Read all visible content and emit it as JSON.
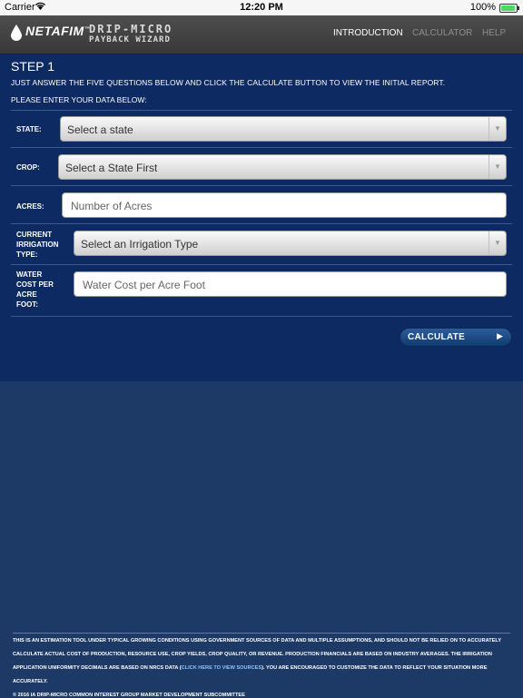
{
  "status_bar": {
    "carrier": "Carrier",
    "time": "12:20 PM",
    "battery": "100%",
    "wifi_icon": "wifi-icon",
    "battery_icon": "battery-icon"
  },
  "header": {
    "brand": "NETAFIM",
    "brand_tm": "™",
    "title_line1": "DRIP-MICRO",
    "title_line2": "PAYBACK WIZARD",
    "nav": [
      {
        "label": "INTRODUCTION",
        "active": true
      },
      {
        "label": "CALCULATOR",
        "active": false
      },
      {
        "label": "HELP",
        "active": false
      }
    ]
  },
  "main": {
    "step_title": "STEP 1",
    "intro": "JUST ANSWER THE FIVE QUESTIONS BELOW AND CLICK THE CALCULATE BUTTON TO VIEW THE INITIAL REPORT.",
    "enter_prompt": "PLEASE ENTER YOUR DATA BELOW:",
    "fields": {
      "state": {
        "label": "STATE:",
        "value": "Select a state"
      },
      "crop": {
        "label": "CROP:",
        "value": "Select a State First"
      },
      "acres": {
        "label": "ACRES:",
        "placeholder": "Number of Acres"
      },
      "irrigation": {
        "label_lines": [
          "CURRENT",
          "IRRIGATION",
          "TYPE:"
        ],
        "value": "Select an Irrigation Type"
      },
      "water_cost": {
        "label_lines": [
          "WATER",
          "COST PER",
          "ACRE",
          "FOOT:"
        ],
        "placeholder": "Water Cost per Acre Foot"
      }
    },
    "calculate_label": "CALCULATE"
  },
  "footer": {
    "disclaimer_part1": "THIS IS AN ESTIMATION TOOL UNDER TYPICAL GROWING CONDITIONS USING GOVERNMENT SOURCES OF DATA AND MULTIPLE ASSUMPTIONS, AND SHOULD NOT BE RELIED ON TO ACCURATELY CALCULATE ACTUAL COST OF PRODUCTION, RESOURCE USE, CROP YIELDS, CROP QUALITY, OR REVENUE. PRODUCTION FINANCIALS ARE BASED ON INDUSTRY AVERAGES. THE IRRIGATION APPLICATION UNIFORMITY DECIMALS ARE BASED ON NRCS DATA (",
    "disclaimer_link": "CLICK HERE TO VIEW SOURCES",
    "disclaimer_part2": "). YOU ARE ENCOURAGED TO CUSTOMIZE THE DATA TO REFLECT YOUR SITUATION MORE ACCURATELY.",
    "copyright": "© 2016 IA DRIP-MICRO COMMON INTEREST GROUP MARKET DEVELOPMENT SUBCOMMITTEE"
  },
  "colors": {
    "panel_bg": "#0d2a63",
    "page_bg": "#1d3a66",
    "header_bg": "#444444",
    "link": "#8ec2ff"
  }
}
